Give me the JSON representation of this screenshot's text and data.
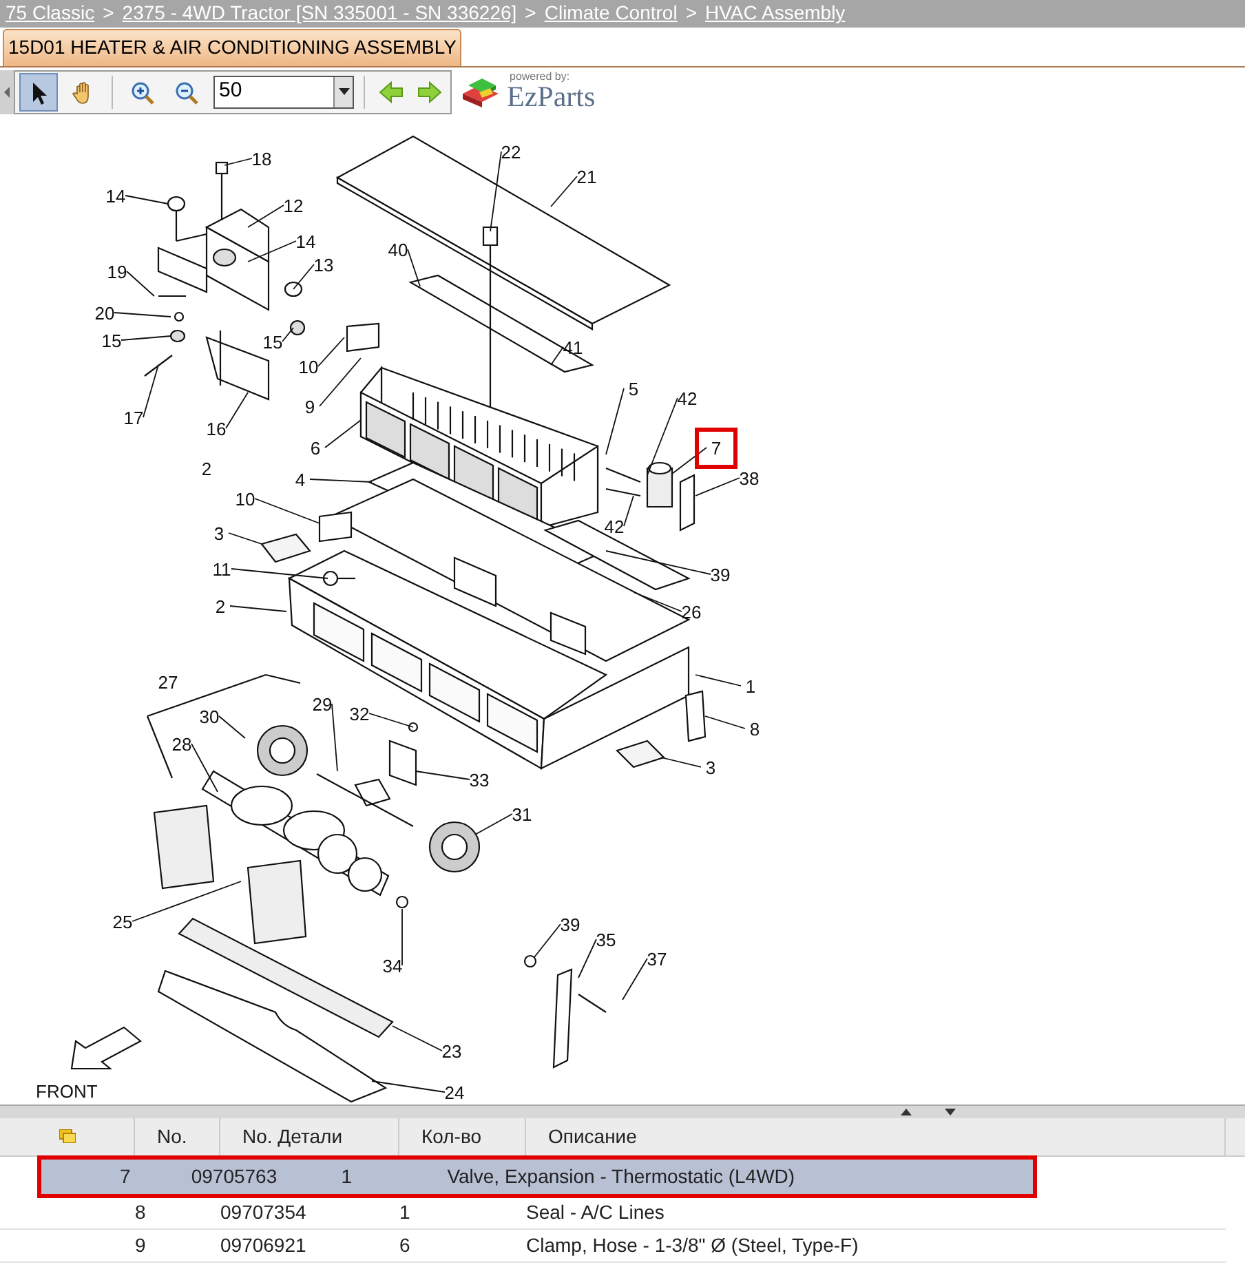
{
  "breadcrumb": [
    {
      "kind": "link",
      "text": "75 Classic"
    },
    {
      "kind": "separator",
      "text": ">"
    },
    {
      "kind": "link",
      "text": "2375 - 4WD Tractor [SN 335001 - SN 336226]"
    },
    {
      "kind": "separator",
      "text": ">"
    },
    {
      "kind": "link",
      "text": "Climate Control"
    },
    {
      "kind": "separator",
      "text": ">"
    },
    {
      "kind": "link",
      "text": "HVAC Assembly"
    }
  ],
  "tabs": [
    {
      "label": "15D01 HEATER & AIR CONDITIONING ASSEMBLY",
      "selected": true
    }
  ],
  "toolbar": {
    "tools": [
      {
        "kind": "select",
        "selected": true
      },
      {
        "kind": "pan",
        "selected": false
      },
      {
        "kind": "zoom-in",
        "selected": false
      },
      {
        "kind": "zoom-out",
        "selected": false
      }
    ],
    "zoom_value": "50",
    "nav": [
      {
        "kind": "back"
      },
      {
        "kind": "forward"
      }
    ],
    "logo": {
      "tagline": "powered by:",
      "name": "EzParts"
    }
  },
  "diagram": {
    "callouts": [
      {
        "label": "18",
        "highlighted": false
      },
      {
        "label": "14",
        "highlighted": false
      },
      {
        "label": "12",
        "highlighted": false
      },
      {
        "label": "14",
        "highlighted": false
      },
      {
        "label": "13",
        "highlighted": false
      },
      {
        "label": "19",
        "highlighted": false
      },
      {
        "label": "20",
        "highlighted": false
      },
      {
        "label": "15",
        "highlighted": false
      },
      {
        "label": "15",
        "highlighted": false
      },
      {
        "label": "17",
        "highlighted": false
      },
      {
        "label": "16",
        "highlighted": false
      },
      {
        "label": "10",
        "highlighted": false
      },
      {
        "label": "9",
        "highlighted": false
      },
      {
        "label": "6",
        "highlighted": false
      },
      {
        "label": "2",
        "highlighted": false
      },
      {
        "label": "4",
        "highlighted": false
      },
      {
        "label": "10",
        "highlighted": false
      },
      {
        "label": "3",
        "highlighted": false
      },
      {
        "label": "11",
        "highlighted": false
      },
      {
        "label": "2",
        "highlighted": false
      },
      {
        "label": "22",
        "highlighted": false
      },
      {
        "label": "21",
        "highlighted": false
      },
      {
        "label": "40",
        "highlighted": false
      },
      {
        "label": "41",
        "highlighted": false
      },
      {
        "label": "5",
        "highlighted": false
      },
      {
        "label": "42",
        "highlighted": false
      },
      {
        "label": "7",
        "highlighted": true
      },
      {
        "label": "38",
        "highlighted": false
      },
      {
        "label": "42",
        "highlighted": false
      },
      {
        "label": "39",
        "highlighted": false
      },
      {
        "label": "26",
        "highlighted": false
      },
      {
        "label": "1",
        "highlighted": false
      },
      {
        "label": "8",
        "highlighted": false
      },
      {
        "label": "3",
        "highlighted": false
      },
      {
        "label": "27",
        "highlighted": false
      },
      {
        "label": "30",
        "highlighted": false
      },
      {
        "label": "29",
        "highlighted": false
      },
      {
        "label": "32",
        "highlighted": false
      },
      {
        "label": "28",
        "highlighted": false
      },
      {
        "label": "33",
        "highlighted": false
      },
      {
        "label": "31",
        "highlighted": false
      },
      {
        "label": "25",
        "highlighted": false
      },
      {
        "label": "34",
        "highlighted": false
      },
      {
        "label": "39",
        "highlighted": false
      },
      {
        "label": "35",
        "highlighted": false
      },
      {
        "label": "37",
        "highlighted": false
      },
      {
        "label": "23",
        "highlighted": false
      },
      {
        "label": "24",
        "highlighted": false
      }
    ],
    "front_label": "FRONT"
  },
  "table": {
    "columns": [
      "No.",
      "No. Детали",
      "Кол-во",
      "Описание"
    ],
    "rows": [
      {
        "no": "7",
        "part_number": "09705763",
        "qty": "1",
        "description": "Valve, Expansion - Thermostatic (L4WD)",
        "selected": true
      },
      {
        "no": "8",
        "part_number": "09707354",
        "qty": "1",
        "description": "Seal - A/C Lines",
        "selected": false
      },
      {
        "no": "9",
        "part_number": "09706921",
        "qty": "6",
        "description": "Clamp, Hose - 1-3/8\" Ø (Steel, Type-F)",
        "selected": false
      }
    ]
  }
}
